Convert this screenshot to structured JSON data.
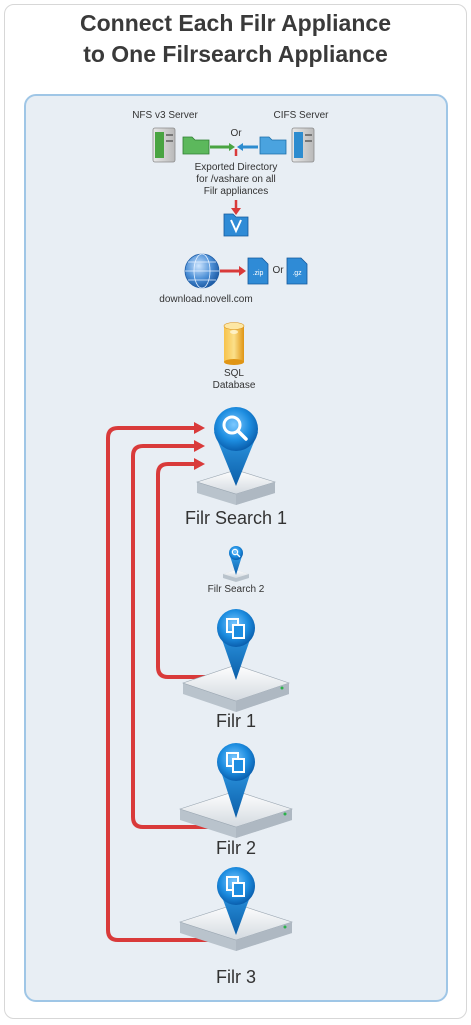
{
  "title_line1": "Connect Each Filr Appliance",
  "title_line2": "to One Filrsearch Appliance",
  "nfs_server_label": "NFS v3 Server",
  "cifs_server_label": "CIFS Server",
  "or_label_top": "Or",
  "exported_dir_line1": "Exported Directory",
  "exported_dir_line2": "for /vashare on all",
  "exported_dir_line3": "Filr appliances",
  "zip_label": ".zip",
  "gz_label": ".gz",
  "or_label_download": "Or",
  "download_site_label": "download.novell.com",
  "sql_line1": "SQL",
  "sql_line2": "Database",
  "filr_search_1_label": "Filr Search 1",
  "filr_search_2_label": "Filr Search 2",
  "filr_1_label": "Filr 1",
  "filr_2_label": "Filr 2",
  "filr_3_label": "Filr 3",
  "colors": {
    "connector_red": "#d93a3a",
    "panel_bg": "#e8eef4",
    "panel_border": "#9fc6e6",
    "appliance_blue": "#1a86d8",
    "server_green": "#49a441",
    "server_blue": "#2d8ccf",
    "sql_orange": "#f0a81d"
  }
}
